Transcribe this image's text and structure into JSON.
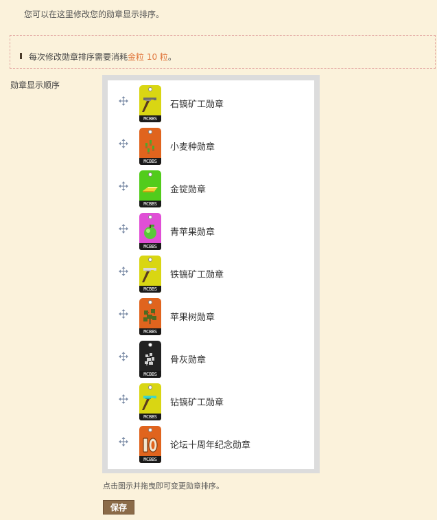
{
  "intro_text": "您可以在这里修改您的勋章显示排序。",
  "notice": {
    "prefix": "每次修改勋章排序需要消耗",
    "cost": "金粒 10 粒",
    "suffix": "。",
    "cost_color": "#e0763c"
  },
  "order_label": "勋章显示顺序",
  "badge_text": "MCBBS",
  "medals": [
    {
      "name": "石镐矿工勋章",
      "badge_color": "#d9d613",
      "icon": "stone-pickaxe-icon"
    },
    {
      "name": "小麦种勋章",
      "badge_color": "#e0641e",
      "icon": "wheat-seeds-icon"
    },
    {
      "name": "金锭勋章",
      "badge_color": "#52cc1c",
      "icon": "gold-ingot-icon"
    },
    {
      "name": "青苹果勋章",
      "badge_color": "#e04fd6",
      "icon": "green-apple-icon"
    },
    {
      "name": "铁镐矿工勋章",
      "badge_color": "#d9d613",
      "icon": "iron-pickaxe-icon"
    },
    {
      "name": "苹果树勋章",
      "badge_color": "#e0641e",
      "icon": "apple-tree-icon"
    },
    {
      "name": "骨灰勋章",
      "badge_color": "#222222",
      "icon": "bone-meal-icon"
    },
    {
      "name": "钻镐矿工勋章",
      "badge_color": "#d9d613",
      "icon": "diamond-pickaxe-icon"
    },
    {
      "name": "论坛十周年纪念勋章",
      "badge_color": "#e0641e",
      "icon": "tenth-anniversary-icon"
    }
  ],
  "hint_text": "点击图示并拖曳即可变更勋章排序。",
  "save_label": "保存"
}
